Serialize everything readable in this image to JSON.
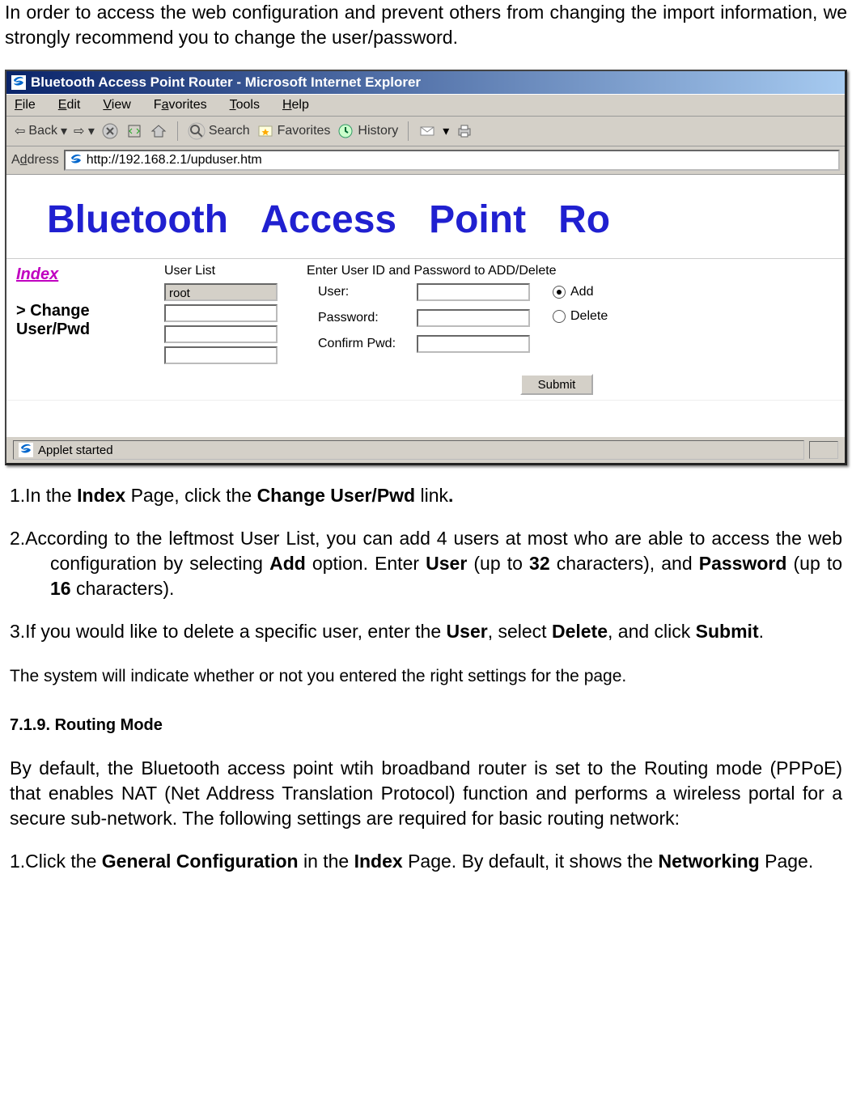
{
  "doc": {
    "intro": "In order to access the web configuration and prevent others from changing the import information, we strongly recommend you to change the user/password.",
    "step1_pre": "1.In the ",
    "step1_b1": "Index",
    "step1_mid1": " Page, click the ",
    "step1_b2": "Change User/Pwd",
    "step1_mid2": " link",
    "step1_b3": ".",
    "step2_pre": "2.According to the leftmost User List, you can add 4 users at most who are able to access the web configuration by selecting ",
    "step2_b1": "Add",
    "step2_mid1": " option.  Enter ",
    "step2_b2": "User",
    "step2_mid2": " (up to ",
    "step2_b3": "32",
    "step2_mid3": " characters), and ",
    "step2_b4": "Password",
    "step2_mid4": " (up to ",
    "step2_b5": "16",
    "step2_mid5": " characters).",
    "step3_pre": "3.If you would like to delete a specific user, enter the ",
    "step3_b1": "User",
    "step3_mid1": ", select ",
    "step3_b2": "Delete",
    "step3_mid2": ", and click ",
    "step3_b3": "Submit",
    "step3_end": ".",
    "note": "The system will indicate whether or not you entered the right settings for the page.",
    "section": "7.1.9. Routing Mode",
    "routing_para": "By default, the Bluetooth access point wtih broadband router is set to the Routing mode (PPPoE) that enables NAT (Net Address Translation Protocol) function and performs a wireless portal for a secure sub-network. The following settings are required for basic routing network:",
    "rstep1_pre": "1.Click the ",
    "rstep1_b1": "General Configuration",
    "rstep1_mid1": " in the ",
    "rstep1_b2": "Index",
    "rstep1_mid2": " Page.  By default, it shows the ",
    "rstep1_b3": "Networking",
    "rstep1_end": " Page."
  },
  "ie": {
    "title": "Bluetooth Access Point Router - Microsoft Internet Explorer",
    "menu": {
      "file": "File",
      "edit": "Edit",
      "view": "View",
      "fav": "Favorites",
      "tools": "Tools",
      "help": "Help"
    },
    "tb": {
      "back": "Back",
      "search": "Search",
      "favs": "Favorites",
      "hist": "History"
    },
    "addr_label": "Address",
    "addr_value": "http://192.168.2.1/upduser.htm",
    "banner": {
      "w1": "Bluetooth",
      "w2": "Access",
      "w3": "Point",
      "w4": "Ro"
    },
    "sidebar": {
      "index": "Index",
      "sel": "> Change User/Pwd"
    },
    "form": {
      "userlist_label": "User List",
      "enter_label": "Enter User ID and Password to ADD/Delete",
      "user0": "root",
      "user_label": "User:",
      "pw_label": "Password:",
      "conf_label": "Confirm Pwd:",
      "add": "Add",
      "del": "Delete",
      "submit": "Submit"
    },
    "status": "Applet started"
  }
}
